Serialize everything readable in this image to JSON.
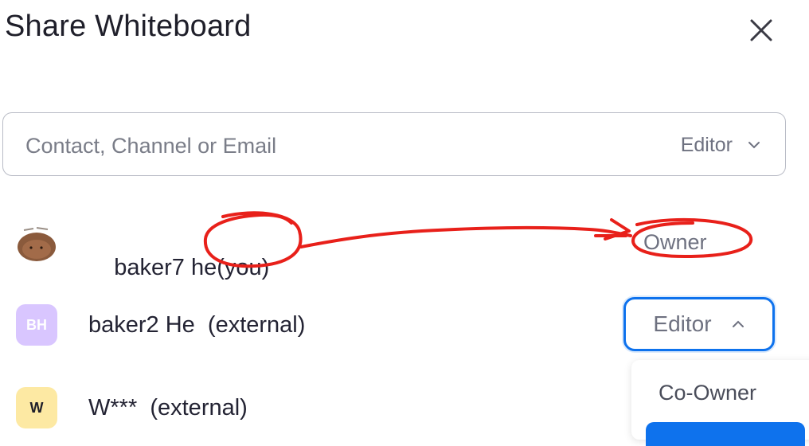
{
  "dialog": {
    "title": "Share Whiteboard",
    "close_icon": "close-icon"
  },
  "search": {
    "placeholder": "Contact, Channel or Email",
    "value": "",
    "role_label": "Editor"
  },
  "members": [
    {
      "name": "baker7 he",
      "suffix": "(you)",
      "role": "Owner",
      "avatar": "photo-avatar"
    },
    {
      "name": "baker2 He  (external)",
      "role": "Editor",
      "avatar_initials": "BH",
      "avatar_color": "#d9c6ff",
      "avatar_text_color": "#ffffff"
    },
    {
      "name": "W***  (external)",
      "avatar_initials": "W",
      "avatar_color": "#fde9a3",
      "avatar_text_color": "#1f1f2a"
    }
  ],
  "dropdown": {
    "options": [
      "Co-Owner"
    ],
    "selected_color": "#0e72ed"
  },
  "colors": {
    "accent": "#0e72ed",
    "annotation": "#e8201a"
  }
}
